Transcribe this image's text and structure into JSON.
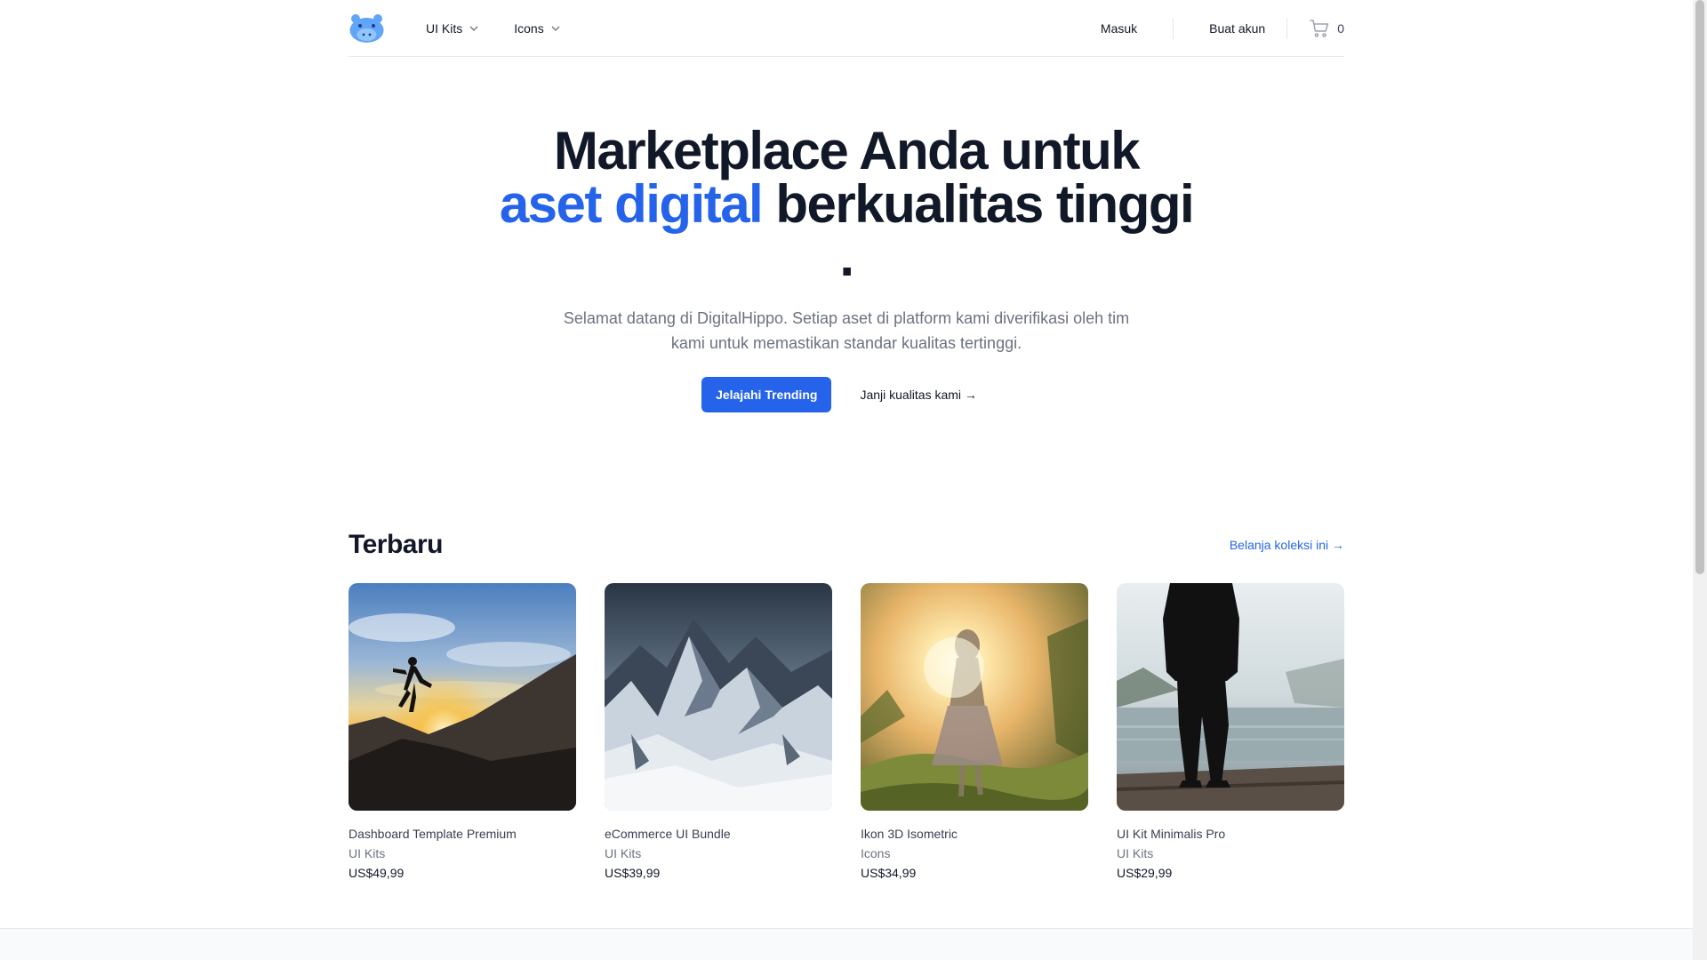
{
  "header": {
    "logo_icon": "hippo-logo-icon",
    "nav": [
      {
        "label": "UI Kits"
      },
      {
        "label": "Icons"
      }
    ],
    "sign_in": "Masuk",
    "create_account": "Buat akun",
    "cart_icon": "shopping-cart-icon",
    "cart_count": "0"
  },
  "hero": {
    "title_part1": "Marketplace Anda untuk ",
    "title_accent": "aset digital",
    "title_part2": " berkualitas tinggi .",
    "subtitle": "Selamat datang di DigitalHippo. Setiap aset di platform kami diverifikasi oleh tim kami untuk memastikan standar kualitas tertinggi.",
    "primary_button": "Jelajahi Trending",
    "secondary_button": "Janji kualitas kami →"
  },
  "section": {
    "title": "Terbaru",
    "link": "Belanja koleksi ini →"
  },
  "products": [
    {
      "name": "Dashboard Template Premium",
      "category": "UI Kits",
      "price": "US$49,99",
      "image": "silhouette-jumping-sunset-image"
    },
    {
      "name": "eCommerce UI Bundle",
      "category": "UI Kits",
      "price": "US$39,99",
      "image": "snowy-mountains-image"
    },
    {
      "name": "Ikon 3D Isometric",
      "category": "Icons",
      "price": "US$34,99",
      "image": "woman-sunlight-field-image"
    },
    {
      "name": "UI Kit Minimalis Pro",
      "category": "UI Kits",
      "price": "US$29,99",
      "image": "man-misty-lake-image"
    }
  ],
  "colors": {
    "accent": "#2563eb",
    "text": "#111827",
    "muted": "#6b7280",
    "border": "#e5e7eb"
  }
}
